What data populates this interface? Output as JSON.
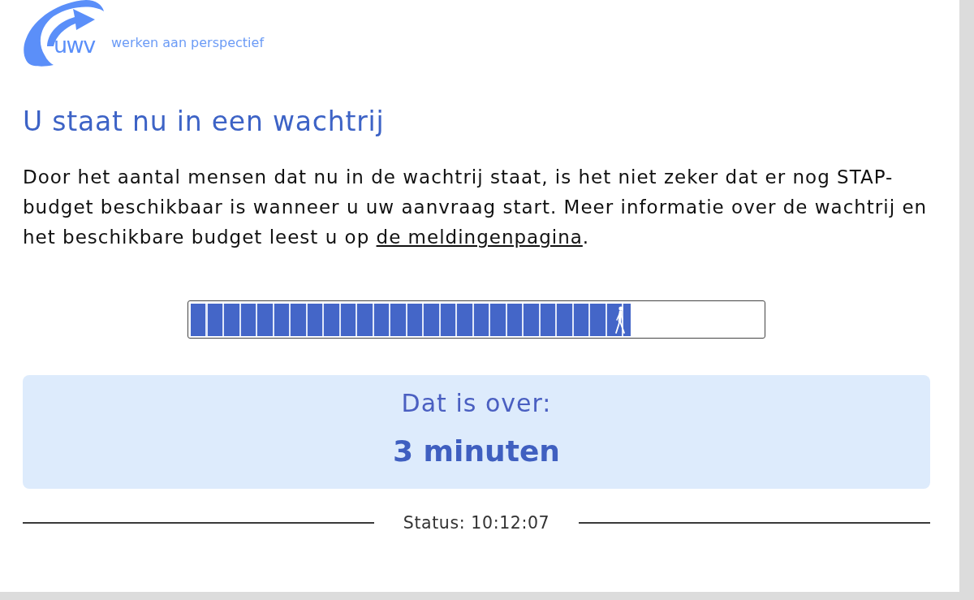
{
  "header": {
    "logo_text": "uwv",
    "tagline": "werken aan perspectief"
  },
  "title": "U staat nu in een wachtrij",
  "intro": {
    "text": "Door het aantal mensen dat nu in de wachtrij staat, is het niet zeker dat er nog STAP-budget beschikbaar is wanneer u uw aanvraag start. Meer informatie over de wachtrij en het beschikbare budget leest u op ",
    "link": "de meldingenpagina",
    "after": "."
  },
  "progress": {
    "level": 0.77
  },
  "wait_box": {
    "label": "Dat is over:",
    "value": "3 minuten"
  },
  "status": {
    "text": "Status: 10:12:07"
  }
}
